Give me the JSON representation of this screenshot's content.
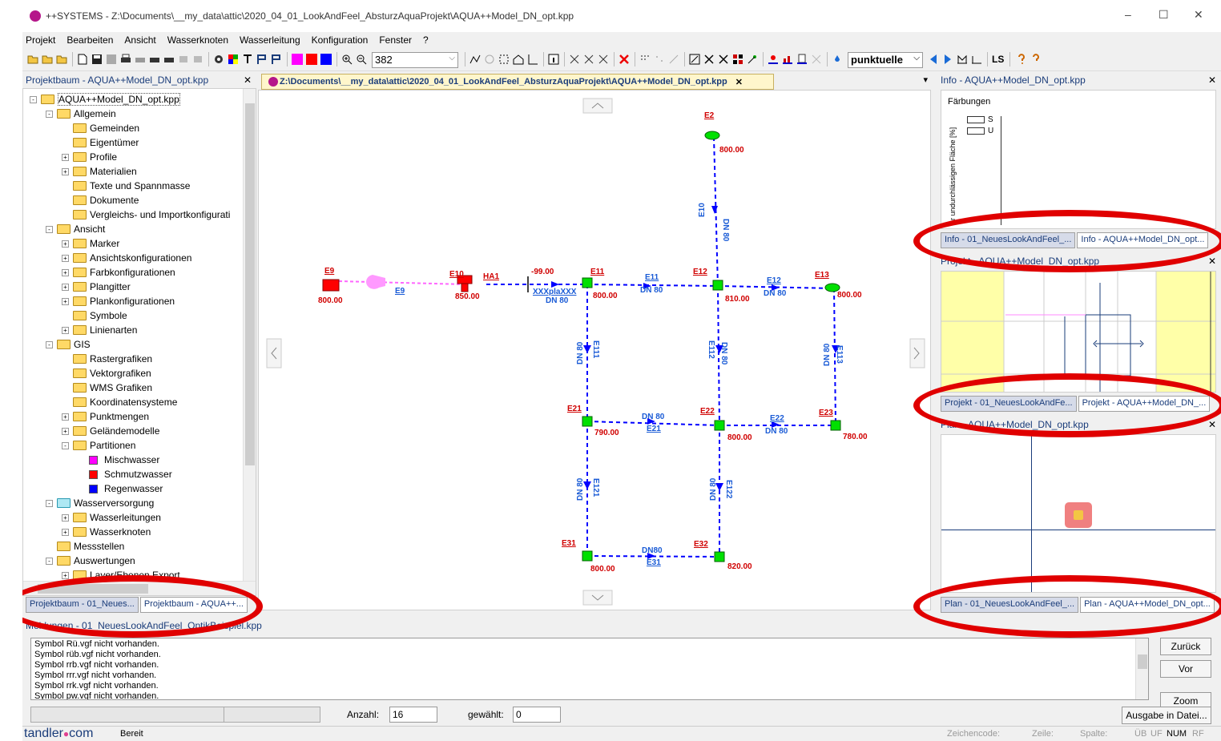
{
  "window": {
    "title": "++SYSTEMS - Z:\\Documents\\__my_data\\attic\\2020_04_01_LookAndFeel_AbsturzAquaProjekt\\AQUA++Model_DN_opt.kpp",
    "btn_min": "–",
    "btn_max": "☐",
    "btn_close": "✕"
  },
  "menu": [
    "Projekt",
    "Bearbeiten",
    "Ansicht",
    "Wasserknoten",
    "Wasserleitung",
    "Konfiguration",
    "Fenster",
    "?"
  ],
  "toolbar": {
    "zoom_value": "382",
    "mode_value": "punktuelle",
    "ls_label": "LS"
  },
  "left": {
    "header": "Projektbaum - AQUA++Model_DN_opt.kpp",
    "close": "✕",
    "tree": [
      {
        "label": "AQUA++Model_DN_opt.kpp",
        "level": 0,
        "exp": "-"
      },
      {
        "label": "Allgemein",
        "level": 1,
        "exp": "-"
      },
      {
        "label": "Gemeinden",
        "level": 2,
        "exp": ""
      },
      {
        "label": "Eigentümer",
        "level": 2,
        "exp": ""
      },
      {
        "label": "Profile",
        "level": 2,
        "exp": "+"
      },
      {
        "label": "Materialien",
        "level": 2,
        "exp": "+"
      },
      {
        "label": "Texte und Spannmasse",
        "level": 2,
        "exp": ""
      },
      {
        "label": "Dokumente",
        "level": 2,
        "exp": ""
      },
      {
        "label": "Vergleichs- und Importkonfigurati",
        "level": 2,
        "exp": ""
      },
      {
        "label": "Ansicht",
        "level": 1,
        "exp": "-"
      },
      {
        "label": "Marker",
        "level": 2,
        "exp": "+"
      },
      {
        "label": "Ansichtskonfigurationen",
        "level": 2,
        "exp": "+"
      },
      {
        "label": "Farbkonfigurationen",
        "level": 2,
        "exp": "+"
      },
      {
        "label": "Plangitter",
        "level": 2,
        "exp": "+"
      },
      {
        "label": "Plankonfigurationen",
        "level": 2,
        "exp": "+"
      },
      {
        "label": "Symbole",
        "level": 2,
        "exp": ""
      },
      {
        "label": "Linienarten",
        "level": 2,
        "exp": "+"
      },
      {
        "label": "GIS",
        "level": 1,
        "exp": "-"
      },
      {
        "label": "Rastergrafiken",
        "level": 2,
        "exp": ""
      },
      {
        "label": "Vektorgrafiken",
        "level": 2,
        "exp": ""
      },
      {
        "label": "WMS Grafiken",
        "level": 2,
        "exp": ""
      },
      {
        "label": "Koordinatensysteme",
        "level": 2,
        "exp": ""
      },
      {
        "label": "Punktmengen",
        "level": 2,
        "exp": "+"
      },
      {
        "label": "Geländemodelle",
        "level": 2,
        "exp": "+"
      },
      {
        "label": "Partitionen",
        "level": 2,
        "exp": "-"
      },
      {
        "label": "Mischwasser",
        "level": 3,
        "exp": "",
        "color": "#ff00ff"
      },
      {
        "label": "Schmutzwasser",
        "level": 3,
        "exp": "",
        "color": "#ff0000"
      },
      {
        "label": "Regenwasser",
        "level": 3,
        "exp": "",
        "color": "#0000ff"
      },
      {
        "label": "Wasserversorgung",
        "level": 1,
        "exp": "-",
        "cyan": true
      },
      {
        "label": "Wasserleitungen",
        "level": 2,
        "exp": "+"
      },
      {
        "label": "Wasserknoten",
        "level": 2,
        "exp": "+"
      },
      {
        "label": "Messstellen",
        "level": 1,
        "exp": ""
      },
      {
        "label": "Auswertungen",
        "level": 1,
        "exp": "-"
      },
      {
        "label": "Layer/Ebenen Export",
        "level": 2,
        "exp": "+"
      }
    ],
    "tabs": [
      "Projektbaum - 01_Neues...",
      "Projektbaum - AQUA++..."
    ]
  },
  "doc": {
    "tab_title": "Z:\\Documents\\__my_data\\attic\\2020_04_01_LookAndFeel_AbsturzAquaProjekt\\AQUA++Model_DN_opt.kpp",
    "tab_close": "✕",
    "dropdown": "▾"
  },
  "network": {
    "nodes": {
      "E2": "E2",
      "E9": "E9",
      "E10": "E10",
      "E11": "E11",
      "E12": "E12",
      "E13": "E13",
      "E21": "E21",
      "E22": "E22",
      "E23": "E23",
      "E31": "E31",
      "E32": "E32"
    },
    "heights": {
      "E2": "800.00",
      "E9": "800.00",
      "E10": "850.00",
      "E11": "800.00",
      "E12": "810.00",
      "E13": "800.00",
      "E21": "790.00",
      "E22": "800.00",
      "E23": "780.00",
      "E31": "800.00",
      "E32": "820.00"
    },
    "pipes": {
      "dn": "DN 80",
      "dn_nospace": "DN80",
      "ha1": "HA1",
      "val_neg": "-99.00",
      "xxx": "XXXplaXXX",
      "l_e9": "E9",
      "l_e10": "E10",
      "l_e11": "E11",
      "l_e12": "E12",
      "l_e111": "E111",
      "l_e112": "E112",
      "l_e113": "E113",
      "l_e21": "E21",
      "l_e22": "E22",
      "l_e121": "E121",
      "l_e122": "E122",
      "l_e31": "E31"
    }
  },
  "info": {
    "header": "Info - AQUA++Model_DN_opt.kpp",
    "close": "✕",
    "faerbungen": "Färbungen",
    "s": "S",
    "u": "U",
    "vertical_label": "er undurchlässigen Fläche [%]",
    "tabs": [
      "Info - 01_NeuesLookAndFeel_...",
      "Info - AQUA++Model_DN_opt..."
    ]
  },
  "projekt": {
    "header": "Projekt - AQUA++Model_DN_opt.kpp",
    "close": "✕",
    "tabs": [
      "Projekt - 01_NeuesLookAndFe...",
      "Projekt - AQUA++Model_DN_..."
    ]
  },
  "plan": {
    "header": "Plan - AQUA++Model_DN_opt.kpp",
    "close": "✕",
    "tabs": [
      "Plan - 01_NeuesLookAndFeel_...",
      "Plan - AQUA++Model_DN_opt..."
    ]
  },
  "output": {
    "header": "Meldungen - 01_NeuesLookAndFeel_OptikBeispiel.kpp",
    "lines": [
      "Symbol Rü.vgf nicht vorhanden.",
      "Symbol rüb.vgf nicht vorhanden.",
      "Symbol rrb.vgf nicht vorhanden.",
      "Symbol rrr.vgf nicht vorhanden.",
      "Symbol rrk.vgf nicht vorhanden.",
      "Symbol pw.vgf nicht vorhanden."
    ],
    "btn_back": "Zurück",
    "btn_fwd": "Vor",
    "btn_zoom": "Zoom",
    "btn_export": "Ausgabe in Datei...",
    "anzahl_label": "Anzahl:",
    "anzahl_value": "16",
    "gewaehlt_label": "gewählt:",
    "gewaehlt_value": "0"
  },
  "status": {
    "brand_a": "tandler",
    "brand_b": "com",
    "ready": "Bereit",
    "zeichencode": "Zeichencode:",
    "zeile": "Zeile:",
    "spalte": "Spalte:",
    "ub": "ÜB",
    "uf": "UF",
    "num": "NUM",
    "rf": "RF"
  },
  "colors": {
    "accent": "#1a3c7a",
    "highlight_ellipse": "#e00000",
    "node_green": "#00e000",
    "pipe_blue": "#0000ff",
    "label_red": "#d00000"
  }
}
